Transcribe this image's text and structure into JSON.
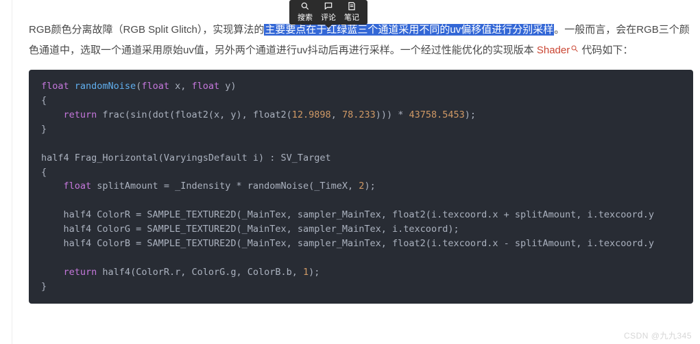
{
  "tooltip": {
    "search": "搜索",
    "comment": "评论",
    "note": "笔记"
  },
  "paragraph": {
    "pre": "RGB颜色分离故障（RGB Split Glitch），实现算法的",
    "highlight": "主要要点在于红绿蓝三个通道采用不同的uv偏移值进行分别采样",
    "mid": "。一般而言，会在RGB三个颜色通道中，选取一个通道采用原始uv值，另外两个通道进行uv抖动后再进行采样。一个经过性能优化的实现版本 ",
    "link": "Shader",
    "post": " 代码如下：",
    "link_icon_name": "search-icon"
  },
  "code": {
    "line1_a": "float",
    "line1_b": " randomNoise",
    "line1_c": "(",
    "line1_d": "float",
    "line1_e": " x, ",
    "line1_f": "float",
    "line1_g": " y)",
    "line2": "{",
    "line3_a": "    ",
    "line3_b": "return",
    "line3_c": " frac(sin(dot(float2(x, y), float2(",
    "line3_d": "12.9898",
    "line3_e": ", ",
    "line3_f": "78.233",
    "line3_g": "))) * ",
    "line3_h": "43758.5453",
    "line3_i": ");",
    "line4": "}",
    "line6": "half4 Frag_Horizontal(VaryingsDefault i) : SV_Target",
    "line7": "{",
    "line8_a": "    ",
    "line8_b": "float",
    "line8_c": " splitAmount = _Indensity * randomNoise(_TimeX, ",
    "line8_d": "2",
    "line8_e": ");",
    "line10": "    half4 ColorR = SAMPLE_TEXTURE2D(_MainTex, sampler_MainTex, float2(i.texcoord.x + splitAmount, i.texcoord.y",
    "line11": "    half4 ColorG = SAMPLE_TEXTURE2D(_MainTex, sampler_MainTex, i.texcoord);",
    "line12": "    half4 ColorB = SAMPLE_TEXTURE2D(_MainTex, sampler_MainTex, float2(i.texcoord.x - splitAmount, i.texcoord.y",
    "line14_a": "    ",
    "line14_b": "return",
    "line14_c": " half4(ColorR.r, ColorG.g, ColorB.b, ",
    "line14_d": "1",
    "line14_e": ");",
    "line15": "}"
  },
  "watermark": "CSDN @九九345"
}
